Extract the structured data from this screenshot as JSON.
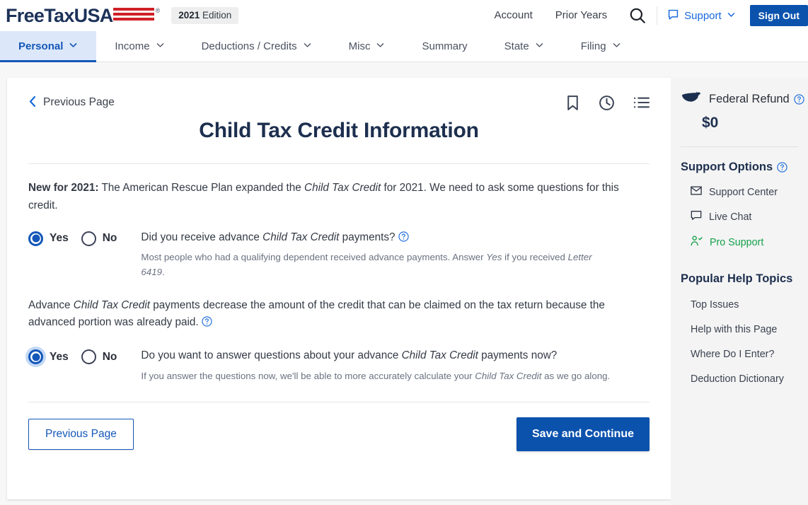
{
  "brand": {
    "logo_text": "FreeTaxUSA",
    "registered_mark": "®",
    "edition_year": "2021",
    "edition_word": "Edition",
    "flag_icon": "us-flag-stripes-icon"
  },
  "topbar": {
    "account_label": "Account",
    "prior_years_label": "Prior Years",
    "search_icon": "search-icon",
    "support_icon": "chat-bubble-icon",
    "support_label": "Support",
    "support_chevron": "chevron-down-icon",
    "sign_out_label": "Sign Out",
    "accent_blue": "#1668dc",
    "signout_bg": "#0b52ad"
  },
  "nav": {
    "items": [
      {
        "label": "Personal",
        "has_chevron": true,
        "active": true
      },
      {
        "label": "Income",
        "has_chevron": true,
        "active": false
      },
      {
        "label": "Deductions / Credits",
        "has_chevron": true,
        "active": false
      },
      {
        "label": "Misc",
        "has_chevron": true,
        "active": false
      },
      {
        "label": "Summary",
        "has_chevron": false,
        "active": false
      },
      {
        "label": "State",
        "has_chevron": true,
        "active": false
      },
      {
        "label": "Filing",
        "has_chevron": true,
        "active": false
      }
    ],
    "active_bg": "#dce8fa",
    "active_color": "#1457b8"
  },
  "main": {
    "previous_page_link": "Previous Page",
    "back_chevron": "chevron-left-icon",
    "header_icons": [
      {
        "name": "bookmark-icon"
      },
      {
        "name": "clock-history-icon"
      },
      {
        "name": "list-menu-icon"
      }
    ],
    "title": "Child Tax Credit Information",
    "intro": {
      "bold_lead": "New for 2021:",
      "part1": " The American Rescue Plan expanded the ",
      "italic1": "Child Tax Credit",
      "part2": " for 2021. We need to ask some questions for this credit."
    },
    "question1": {
      "options": [
        {
          "label": "Yes",
          "selected": true,
          "focused": false
        },
        {
          "label": "No",
          "selected": false,
          "focused": false
        }
      ],
      "text_part1": "Did you receive advance ",
      "text_italic": "Child Tax Credit",
      "text_part2": " payments?",
      "help_icon": "question-mark-circle-icon",
      "sub_part1": "Most people who had a qualifying dependent received advance payments. Answer ",
      "sub_italic1": "Yes",
      "sub_part2": " if you received ",
      "sub_italic2": "Letter 6419",
      "sub_part3": "."
    },
    "middle_paragraph": {
      "part1": "Advance ",
      "italic1": "Child Tax Credit",
      "part2": " payments decrease the amount of the credit that can be claimed on the tax return because the advanced portion was already paid.",
      "help_icon": "question-mark-circle-icon"
    },
    "question2": {
      "options": [
        {
          "label": "Yes",
          "selected": true,
          "focused": true
        },
        {
          "label": "No",
          "selected": false,
          "focused": false
        }
      ],
      "text_part1": "Do you want to answer questions about your advance ",
      "text_italic": "Child Tax Credit",
      "text_part2": " payments now?",
      "sub_part1": "If you answer the questions now, we'll be able to more accurately calculate your ",
      "sub_italic1": "Child Tax Credit",
      "sub_part2": " as we go along."
    },
    "buttons": {
      "previous_label": "Previous Page",
      "save_label": "Save and Continue",
      "save_bg": "#0b52ad"
    }
  },
  "sidebar": {
    "refund": {
      "map_icon": "us-map-icon",
      "label": "Federal Refund",
      "help_icon": "question-mark-circle-icon",
      "amount": "$0"
    },
    "support_options": {
      "heading": "Support Options",
      "help_icon": "question-mark-circle-icon",
      "items": [
        {
          "label": "Support Center",
          "icon": "envelope-icon",
          "green": false
        },
        {
          "label": "Live Chat",
          "icon": "chat-bubble-icon",
          "green": false
        },
        {
          "label": "Pro Support",
          "icon": "person-check-icon",
          "green": true
        }
      ],
      "green_color": "#15a04a"
    },
    "popular_help": {
      "heading": "Popular Help Topics",
      "links": [
        "Top Issues",
        "Help with this Page",
        "Where Do I Enter?",
        "Deduction Dictionary"
      ]
    }
  }
}
